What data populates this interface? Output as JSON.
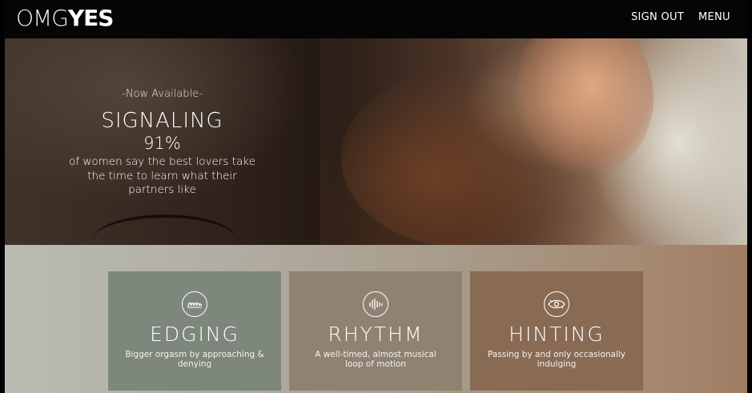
{
  "header": {
    "logo_light": "OMG",
    "logo_bold": "YES",
    "sign_out": "SIGN OUT",
    "menu": "MENU"
  },
  "hero": {
    "availability": "-Now Available-",
    "title": "SIGNALING",
    "stat": "91%",
    "description": "of women say the best lovers take the time to learn what their partners like"
  },
  "cards": [
    {
      "icon": "wave-edging-icon",
      "title": "EDGING",
      "description": "Bigger orgasm by approaching & denying"
    },
    {
      "icon": "rhythm-bars-icon",
      "title": "RHYTHM",
      "description": "A well-timed, almost musical loop of motion"
    },
    {
      "icon": "eye-loop-icon",
      "title": "HINTING",
      "description": "Passing by and only occasionally indulging"
    }
  ],
  "colors": {
    "header_bg": "#050505",
    "card_edging": "#7d877c",
    "card_rhythm": "#8f8272",
    "card_hinting": "#896a53"
  }
}
